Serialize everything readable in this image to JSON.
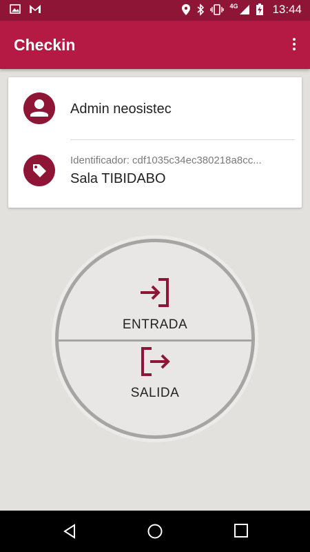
{
  "status_bar": {
    "time": "13:44",
    "network": "4G",
    "icons_left": [
      "image-icon",
      "gmail-icon"
    ],
    "icons_right": [
      "location-icon",
      "bluetooth-icon",
      "vibrate-icon",
      "signal-icon",
      "battery-charging-icon"
    ]
  },
  "app_bar": {
    "title": "Checkin",
    "menu_icon": "more-vert-icon"
  },
  "card": {
    "user_name": "Admin neosistec",
    "user_icon": "person-icon",
    "room_identifier": "Identificador: cdf1035c34ec380218a8cc...",
    "room_name": "Sala TIBIDABO",
    "room_icon": "tag-icon"
  },
  "actions": {
    "entry_label": "ENTRADA",
    "entry_icon": "login-icon",
    "exit_label": "SALIDA",
    "exit_icon": "logout-icon"
  },
  "nav_bar": {
    "buttons": [
      "back-icon",
      "home-icon",
      "recents-icon"
    ]
  },
  "colors": {
    "primary": "#b51a44",
    "primary_dark": "#8f1537",
    "background": "#e3e1dd"
  }
}
